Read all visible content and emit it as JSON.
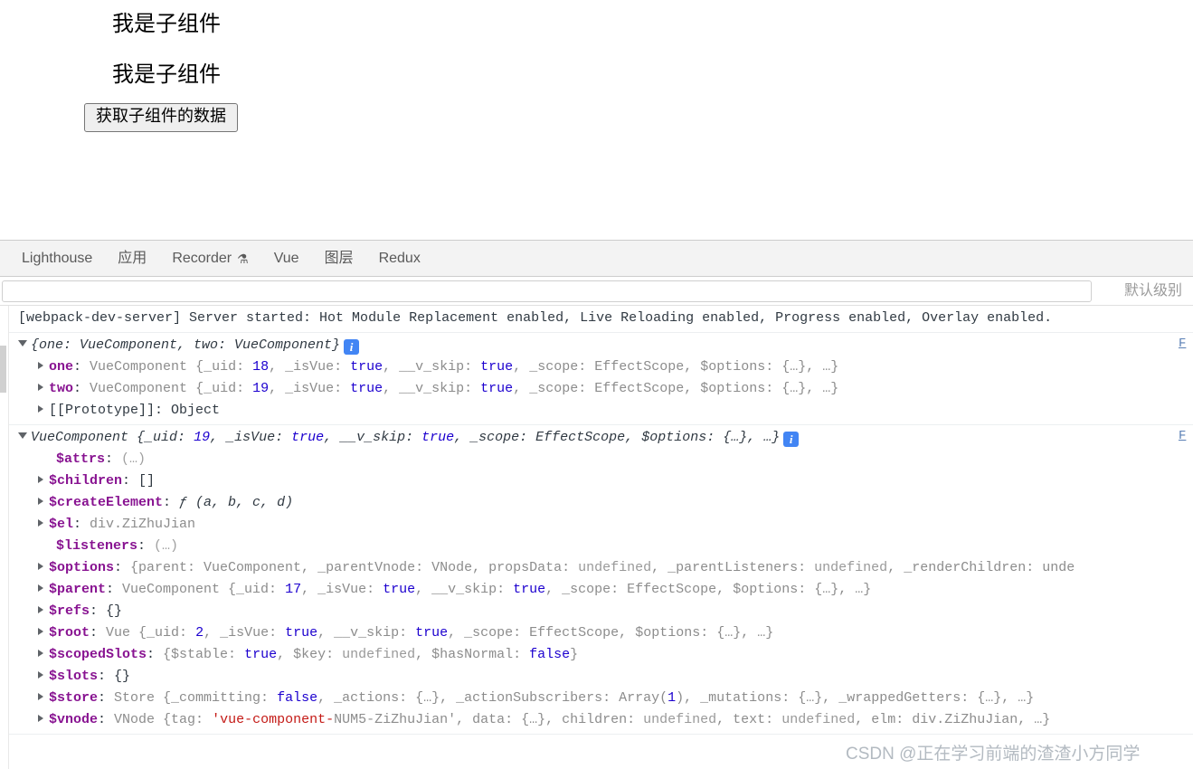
{
  "page": {
    "heading_1": "我是子组件",
    "heading_2": "我是子组件",
    "button_label": "获取子组件的数据"
  },
  "devtools": {
    "tabs": [
      {
        "label": "Lighthouse",
        "icon": null
      },
      {
        "label": "应用",
        "icon": null
      },
      {
        "label": "Recorder",
        "icon": "flask-icon"
      },
      {
        "label": "Vue",
        "icon": null
      },
      {
        "label": "图层",
        "icon": null
      },
      {
        "label": "Redux",
        "icon": null
      }
    ],
    "filter": {
      "value": "",
      "placeholder": ""
    },
    "level_select": "默认级别",
    "source_link_1": "F",
    "source_link_2": "F"
  },
  "console": {
    "messages": [
      {
        "type": "log",
        "text": "[webpack-dev-server] Server started: Hot Module Replacement enabled, Live Reloading enabled, Progress enabled, Overlay enabled."
      }
    ],
    "group_one": {
      "header_preview": "{one: VueComponent, two: VueComponent}",
      "rows": [
        {
          "name": "one",
          "class": "VueComponent",
          "body": "{_uid: 18, _isVue: true, __v_skip: true, _scope: EffectScope, $options: {…}, …}",
          "uid": "18"
        },
        {
          "name": "two",
          "class": "VueComponent",
          "body": "{_uid: 19, _isVue: true, __v_skip: true, _scope: EffectScope, $options: {…}, …}",
          "uid": "19"
        }
      ],
      "prototype_row": "[[Prototype]]: Object"
    },
    "group_two": {
      "header_class": "VueComponent",
      "header_preview": "{_uid: 19, _isVue: true, __v_skip: true, _scope: EffectScope, $options: {…}, …}",
      "header_uid": "19",
      "rows": [
        {
          "expandable": false,
          "name": "$attrs",
          "value": "(…)",
          "kind": "getter"
        },
        {
          "expandable": true,
          "name": "$children",
          "value": "[]",
          "kind": "plain"
        },
        {
          "expandable": true,
          "name": "$createElement",
          "value": "ƒ (a, b, c, d)",
          "kind": "function"
        },
        {
          "expandable": true,
          "name": "$el",
          "value": "div.ZiZhuJian",
          "kind": "node"
        },
        {
          "expandable": false,
          "name": "$listeners",
          "value": "(…)",
          "kind": "getter"
        },
        {
          "expandable": true,
          "name": "$options",
          "value": "{parent: VueComponent, _parentVnode: VNode, propsData: undefined, _parentListeners: undefined, _renderChildren: unde",
          "kind": "object"
        },
        {
          "expandable": true,
          "name": "$parent",
          "value": "VueComponent {_uid: 17, _isVue: true, __v_skip: true, _scope: EffectScope, $options: {…}, …}",
          "kind": "object"
        },
        {
          "expandable": true,
          "name": "$refs",
          "value": "{}",
          "kind": "plain"
        },
        {
          "expandable": true,
          "name": "$root",
          "value": "Vue {_uid: 2, _isVue: true, __v_skip: true, _scope: EffectScope, $options: {…}, …}",
          "kind": "object"
        },
        {
          "expandable": true,
          "name": "$scopedSlots",
          "value": "{$stable: true, $key: undefined, $hasNormal: false}",
          "kind": "object"
        },
        {
          "expandable": true,
          "name": "$slots",
          "value": "{}",
          "kind": "plain"
        },
        {
          "expandable": true,
          "name": "$store",
          "value": "Store {_committing: false, _actions: {…}, _actionSubscribers: Array(1), _mutations: {…}, _wrappedGetters: {…}, …}",
          "kind": "object"
        },
        {
          "expandable": true,
          "name": "$vnode",
          "value": "VNode {tag: 'vue-component-5-ZiZhuJian', data: {…}, children: undefined, text: undefined, elm: div.ZiZhuJian, …}",
          "kind": "object"
        }
      ]
    }
  },
  "watermark": "CSDN @正在学习前端的渣渣小方同学"
}
